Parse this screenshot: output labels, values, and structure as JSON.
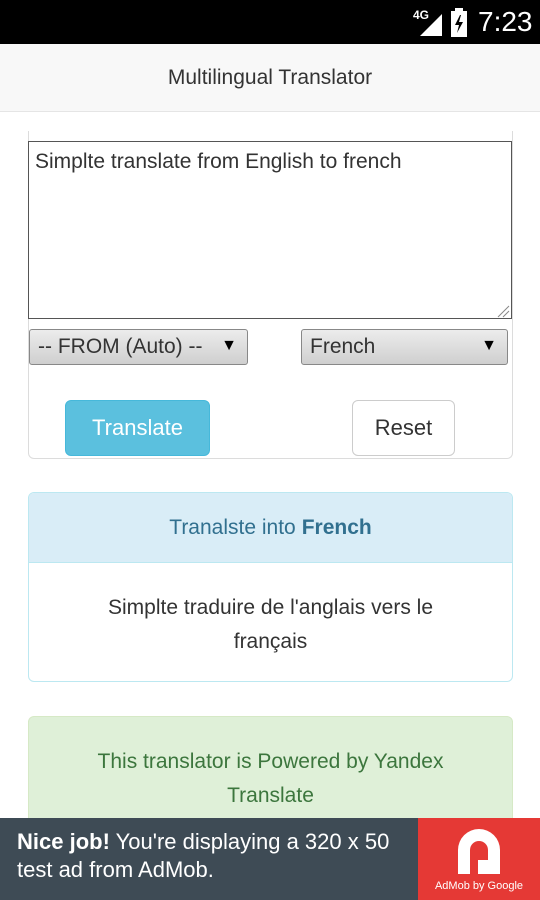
{
  "status_bar": {
    "network": "4G",
    "time": "7:23",
    "icons": [
      "signal-icon",
      "battery-icon"
    ]
  },
  "header": {
    "title": "Multilingual Translator"
  },
  "translator": {
    "source_text": "Simplte translate from English to french",
    "from_select": "-- FROM (Auto) --",
    "to_select": "French",
    "translate_button": "Translate",
    "reset_button": "Reset"
  },
  "result": {
    "heading_prefix": "Tranalste into",
    "heading_language": "French",
    "text": "Simplte traduire de l'anglais vers le français"
  },
  "powered": {
    "text": "This translator is Powered by Yandex Translate"
  },
  "ad": {
    "lead": "Nice job!",
    "text": " You're displaying a 320 x 50 test ad from AdMob.",
    "logo_caption": "AdMob by Google"
  },
  "colors": {
    "info": "#5bc0de",
    "info_panel": "#d9edf7",
    "success_panel": "#dff0d8",
    "ad_bg": "#3e4b55",
    "ad_logo": "#e53935"
  }
}
